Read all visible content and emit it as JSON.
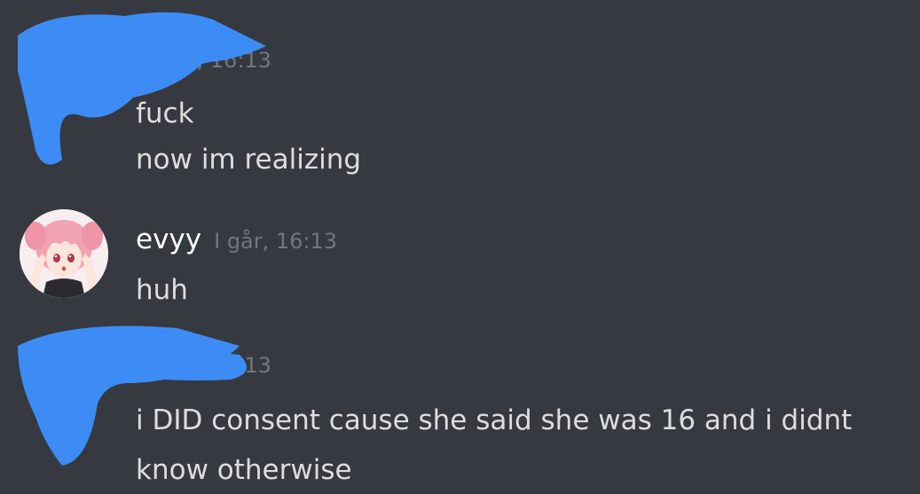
{
  "messages": [
    {
      "id": "msg-1",
      "username": "",
      "timestamp": "I går, 16:13",
      "lines": [
        "fuck",
        "now im realizing"
      ],
      "redacted": true
    },
    {
      "id": "msg-2",
      "username": "evyy",
      "timestamp": "I går, 16:13",
      "lines": [
        "huh"
      ],
      "redacted": false
    },
    {
      "id": "msg-3",
      "username": "",
      "timestamp": "I går, 16:13",
      "lines": [
        "i DID consent cause she said she was 16 and i didnt",
        "know otherwise"
      ],
      "redacted": true
    }
  ],
  "colors": {
    "background": "#36393f",
    "username": "#ffffff",
    "timestamp": "#72767d",
    "text": "#dcddde",
    "redaction": "#3d8cf5",
    "avatar_hair": "#f2a3b3"
  },
  "icons": {
    "evyy_avatar": "anime-avatar-pink-hair"
  }
}
